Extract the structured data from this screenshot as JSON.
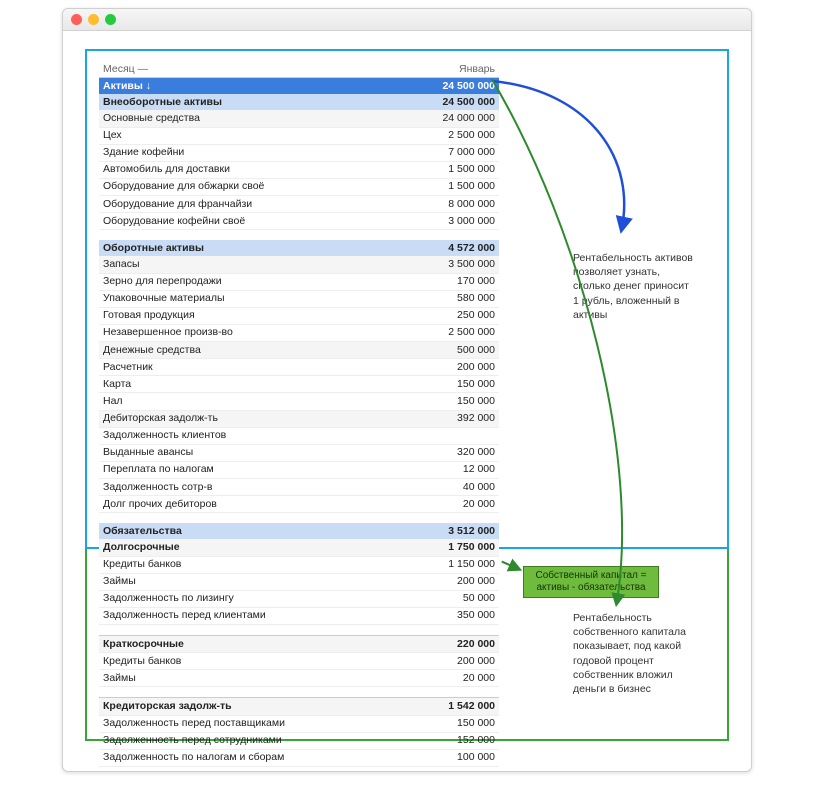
{
  "header": {
    "month_label": "Месяц —",
    "month_value": "Январь"
  },
  "assets": {
    "title": "Активы ↓",
    "total": "24 500 000",
    "noncurrent": {
      "title": "Внеоборотные активы",
      "total": "24 500 000",
      "rows": [
        {
          "label": "Основные средства",
          "value": "24 000 000"
        },
        {
          "label": "Цех",
          "value": "2 500 000"
        },
        {
          "label": "Здание кофейни",
          "value": "7 000 000"
        },
        {
          "label": "Автомобиль для доставки",
          "value": "1 500 000"
        },
        {
          "label": "Оборудование для обжарки своё",
          "value": "1 500 000"
        },
        {
          "label": "Оборудование для франчайзи",
          "value": "8 000 000"
        },
        {
          "label": "Оборудование кофейни своё",
          "value": "3 000 000"
        }
      ]
    },
    "current": {
      "title": "Оборотные активы",
      "total": "4 572 000",
      "rows": [
        {
          "label": "Запасы",
          "value": "3 500 000"
        },
        {
          "label": "Зерно для перепродажи",
          "value": "170 000"
        },
        {
          "label": "Упаковочные материалы",
          "value": "580 000"
        },
        {
          "label": "Готовая продукция",
          "value": "250 000"
        },
        {
          "label": "Незавершенное произв-во",
          "value": "2 500 000"
        },
        {
          "label": "Денежные средства",
          "value": "500 000"
        },
        {
          "label": "Расчетник",
          "value": "200 000"
        },
        {
          "label": "Карта",
          "value": "150 000"
        },
        {
          "label": "Нал",
          "value": "150 000"
        },
        {
          "label": "Дебиторская задолж-ть",
          "value": "392 000"
        },
        {
          "label": "Задолженность клиентов",
          "value": ""
        },
        {
          "label": "Выданные авансы",
          "value": "320 000"
        },
        {
          "label": "Переплата по налогам",
          "value": "12 000"
        },
        {
          "label": "Задолженность сотр-в",
          "value": "40 000"
        },
        {
          "label": "Долг прочих дебиторов",
          "value": "20 000"
        }
      ]
    }
  },
  "liabilities": {
    "title": "Обязательства",
    "total": "3 512 000",
    "long": {
      "title": "Долгосрочные",
      "total": "1 750 000",
      "rows": [
        {
          "label": "Кредиты банков",
          "value": "1 150 000"
        },
        {
          "label": "Займы",
          "value": "200 000"
        },
        {
          "label": "Задолженность по лизингу",
          "value": "50 000"
        },
        {
          "label": "Задолженность перед клиентами",
          "value": "350 000"
        }
      ]
    },
    "short": {
      "title": "Краткосрочные",
      "total": "220 000",
      "rows": [
        {
          "label": "Кредиты банков",
          "value": "200 000"
        },
        {
          "label": "Займы",
          "value": "20 000"
        }
      ]
    },
    "payable": {
      "title": "Кредиторская задолж-ть",
      "total": "1 542 000",
      "rows": [
        {
          "label": "Задолженность перед поставщиками",
          "value": "150 000"
        },
        {
          "label": "Задолженность перед сотрудниками",
          "value": "152 000"
        },
        {
          "label": "Задолженность по налогам и сборам",
          "value": "100 000"
        }
      ]
    }
  },
  "notes": {
    "roa": "Рентабельность активов позволяет узнать, сколько денег приносит 1 рубль, вложенный в активы",
    "equity_badge_line1": "Собственный капитал =",
    "equity_badge_line2": "активы - обязательства",
    "roe": "Рентабельность собственного капитала показывает, под какой годовой процент собственник вложил деньги в бизнес"
  }
}
